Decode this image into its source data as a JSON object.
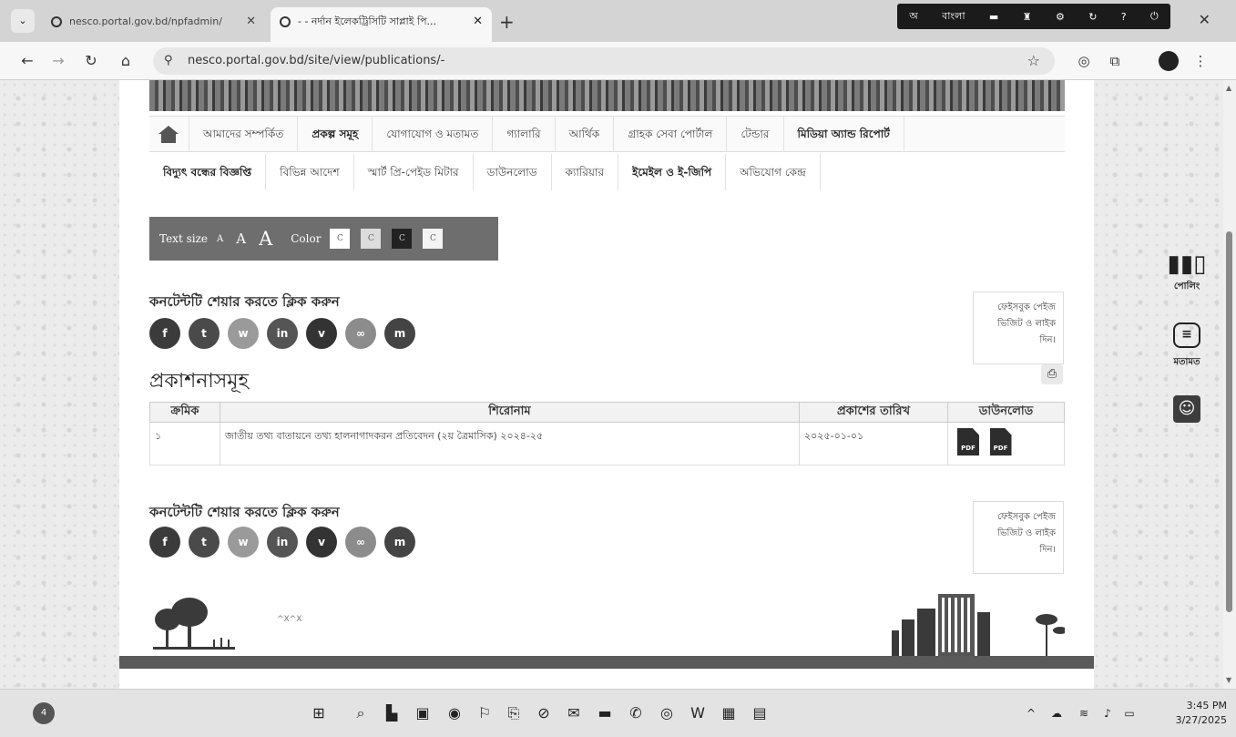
{
  "browser": {
    "tabs": [
      {
        "title": "nesco.portal.gov.bd/npfadmin/",
        "active": false
      },
      {
        "title": "- - নর্দান ইলেকট্রিসিটি সাপ্লাই পি...",
        "active": true
      }
    ],
    "url": "nesco.portal.gov.bd/site/view/publications/-",
    "lang_strip": [
      "অ",
      "বাংলা"
    ]
  },
  "menu": {
    "row1": [
      "আমাদের সম্পর্কিত",
      "প্রকল্প সমূহ",
      "যোগাযোগ ও মতামত",
      "গ্যালারি",
      "আর্থিক",
      "গ্রাহক সেবা পোর্টাল",
      "টেন্ডার",
      "মিডিয়া অ্যান্ড রিপোর্ট"
    ],
    "row2": [
      "বিদ্যুৎ বন্ধের বিজ্ঞপ্তি",
      "বিভিন্ন আদেশ",
      "স্মার্ট প্রি-পেইড মিটার",
      "ডাউনলোড",
      "ক্যারিয়ার",
      "ইমেইল ও ই-জিপি",
      "অভিযোগ কেন্দ্র"
    ]
  },
  "accessibility": {
    "text_size_label": "Text size",
    "sizes": [
      "A",
      "A",
      "A"
    ],
    "color_label": "Color",
    "color_options": [
      "C",
      "C",
      "C",
      "C"
    ],
    "color_swatches": [
      "#ffffff",
      "#dcdcdc",
      "#222222",
      "#f4f4f4"
    ]
  },
  "share": {
    "title": "কনটেন্টটি শেয়ার করতে ক্লিক করুন",
    "icons": [
      {
        "name": "facebook",
        "glyph": "f",
        "color": "#3b3b3b"
      },
      {
        "name": "twitter",
        "glyph": "t",
        "color": "#4a4a4a"
      },
      {
        "name": "whatsapp",
        "glyph": "w",
        "color": "#9a9a9a"
      },
      {
        "name": "linkedin",
        "glyph": "in",
        "color": "#555555"
      },
      {
        "name": "viber",
        "glyph": "v",
        "color": "#333333"
      },
      {
        "name": "link",
        "glyph": "∞",
        "color": "#8c8c8c"
      },
      {
        "name": "messenger",
        "glyph": "m",
        "color": "#444444"
      }
    ],
    "fb_box": "ফেইসবুক পেইজ ভিজিট ও লাইক দিন।"
  },
  "publications": {
    "title": "প্রকাশনাসমূহ",
    "columns": [
      "ক্রমিক",
      "শিরোনাম",
      "প্রকাশের তারিখ",
      "ডাউনলোড"
    ],
    "rows": [
      {
        "serial": "১",
        "title": "জাতীয় তথ্য বাতায়নে তথ্য হালনাগাদকরন প্রতিবেদন (২য় ত্রৈমাসিক) ২০২৪-২৫",
        "date": "২০২৫-০১-০১",
        "files": [
          "PDF",
          "PDF"
        ]
      }
    ]
  },
  "side": {
    "polling_label": "পোলিং",
    "feedback_label": "মতামত"
  },
  "footer_art_text": "^X^X",
  "taskbar": {
    "badge": "4",
    "time": "3:45 PM",
    "date": "3/27/2025"
  }
}
